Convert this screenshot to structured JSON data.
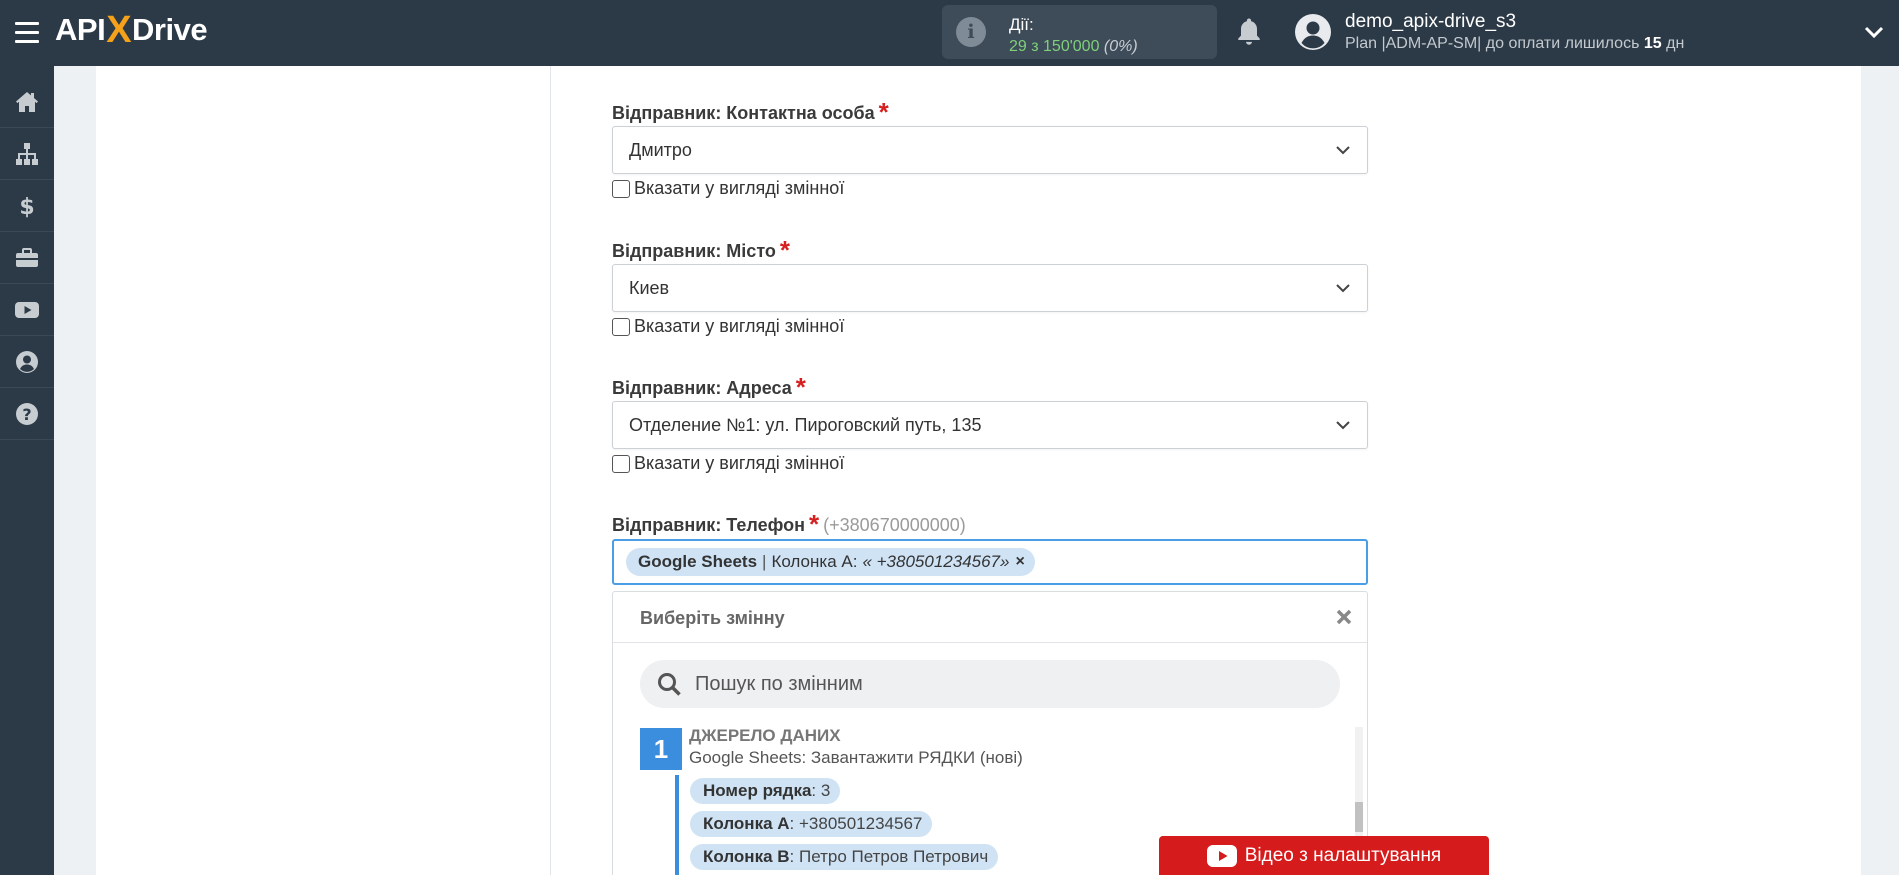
{
  "header": {
    "logo_left": "API",
    "logo_x": "X",
    "logo_right": "Drive",
    "actions_label": "Дії:",
    "actions_value": "29 з 150'000",
    "actions_percent": "(0%)",
    "user_name": "demo_apix-drive_s3",
    "plan_prefix": "Plan |ADM-AP-SM| до оплати лишилось ",
    "plan_days": "15",
    "plan_suffix": " дн"
  },
  "sidebar": {
    "items": [
      "home-icon",
      "sitemap-icon",
      "dollar-icon",
      "briefcase-icon",
      "youtube-icon",
      "user-icon",
      "help-icon"
    ]
  },
  "form": {
    "contact": {
      "label": "Відправник: Контактна особа",
      "required": "*",
      "value": "Дмитро",
      "checkbox_label": "Вказати у вигляді змінної"
    },
    "city": {
      "label": "Відправник: Місто",
      "required": "*",
      "value": "Киев",
      "checkbox_label": "Вказати у вигляді змінної"
    },
    "address": {
      "label": "Відправник: Адреса",
      "required": "*",
      "value": "Отделение №1: ул. Пироговский путь, 135",
      "checkbox_label": "Вказати у вигляді змінної"
    },
    "phone": {
      "label": "Відправник: Телефон",
      "required": "*",
      "hint": "(+380670000000)",
      "tag_source": "Google Sheets",
      "tag_separator": "|",
      "tag_field": "Колонка А:",
      "tag_value": "« +380501234567»",
      "tag_remove": "×"
    }
  },
  "dropdown": {
    "title": "Виберіть змінну",
    "search_placeholder": "Пошук по змінним",
    "source_number": "1",
    "source_title": "ДЖЕРЕЛО ДАНИХ",
    "source_subtitle": "Google Sheets: Завантажити РЯДКИ (нові)",
    "variables": [
      {
        "name": "Номер рядка",
        "value": ": 3"
      },
      {
        "name": "Колонка А",
        "value": ": +380501234567"
      },
      {
        "name": "Колонка B",
        "value": ": Петро Петров Петрович"
      }
    ]
  },
  "video_button": "Відео з налаштування",
  "colors": {
    "topbar": "#2c3a47",
    "accent_blue": "#3b8ddd",
    "required_red": "#d62020",
    "video_red": "#d51b1b",
    "logo_orange": "#f6a11a"
  }
}
